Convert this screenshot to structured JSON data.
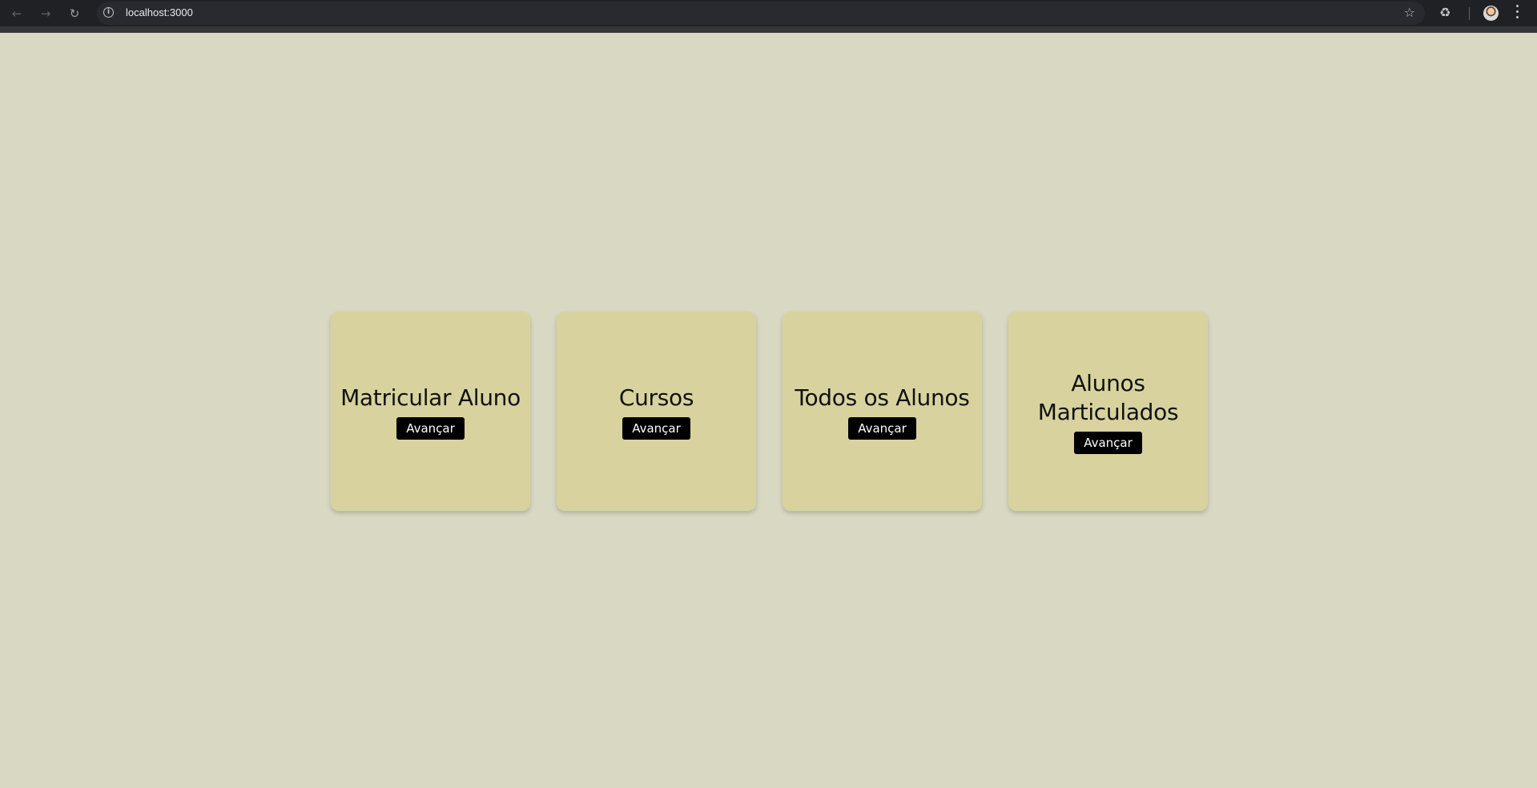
{
  "browser": {
    "url": "localhost:3000",
    "icons": {
      "back": "arrow-left-icon",
      "forward": "arrow-right-icon",
      "reload": "reload-icon",
      "site_info": "info-icon",
      "bookmark": "star-icon",
      "extensions": "puzzle-icon",
      "profile": "avatar",
      "menu": "more-vert-icon"
    }
  },
  "page": {
    "background": "#d9d8c3",
    "card_color": "#d8d39e",
    "button_color": "#000000"
  },
  "cards": [
    {
      "title": "Matricular Aluno",
      "button": "Avançar"
    },
    {
      "title": "Cursos",
      "button": "Avançar"
    },
    {
      "title": "Todos os Alunos",
      "button": "Avançar"
    },
    {
      "title": "Alunos Marticulados",
      "button": "Avançar"
    }
  ]
}
